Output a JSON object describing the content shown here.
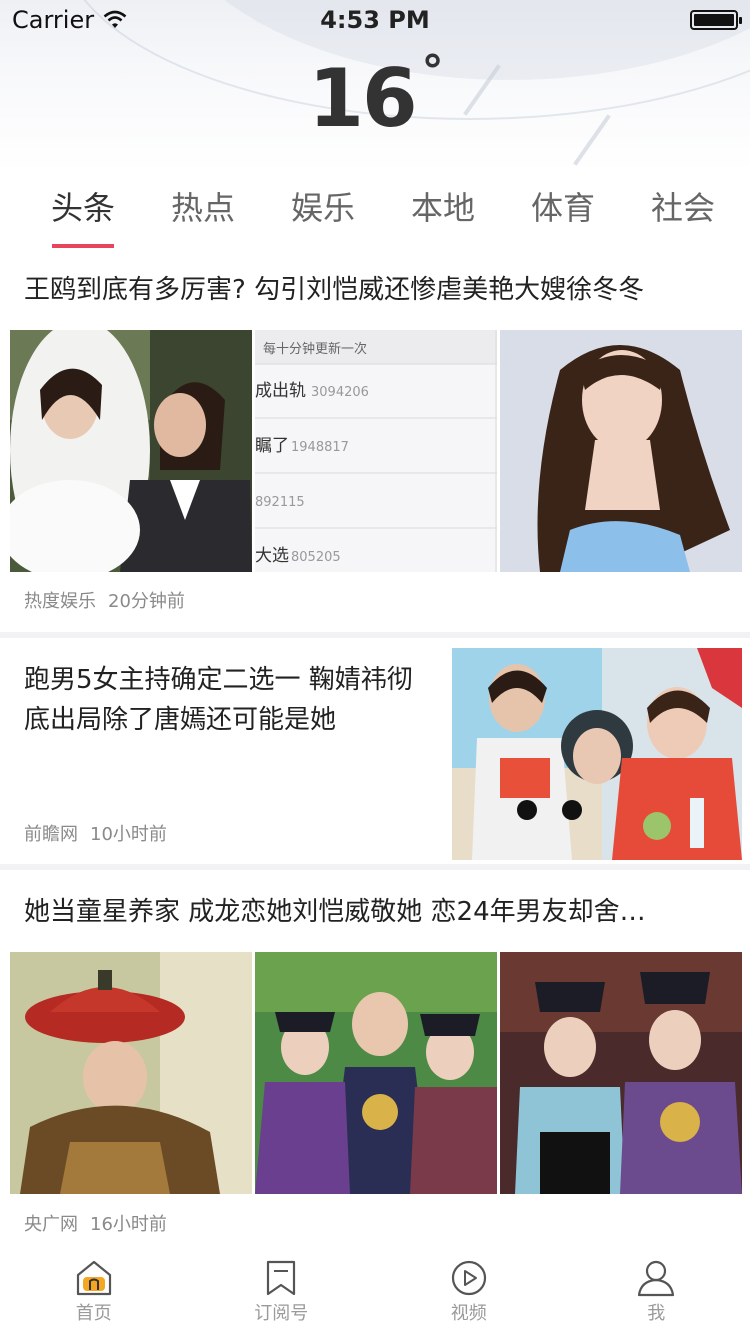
{
  "status": {
    "carrier": "Carrier",
    "time": "4:53 PM"
  },
  "weather": {
    "temperature": "16",
    "degree_symbol": "°"
  },
  "tabs": [
    "头条",
    "热点",
    "娱乐",
    "本地",
    "体育",
    "社会"
  ],
  "active_tab": 0,
  "articles": [
    {
      "title": "王鸥到底有多厉害? 勾引刘恺威还惨虐美艳大嫂徐冬冬",
      "source": "热度娱乐",
      "time": "20分钟前",
      "list_image": {
        "header": "每十分钟更新一次",
        "rows": [
          {
            "label": "成出轨",
            "value": "3094206"
          },
          {
            "label": "瞩了",
            "value": "1948817"
          },
          {
            "label": "",
            "value": "892115"
          },
          {
            "label": "大选",
            "value": "805205"
          }
        ]
      }
    },
    {
      "title": "跑男5女主持确定二选一 鞠婧祎彻底出局除了唐嫣还可能是她",
      "source": "前瞻网",
      "time": "10小时前"
    },
    {
      "title": "她当童星养家 成龙恋她刘恺威敬她 恋24年男友却舍…",
      "source": "央广网",
      "time": "16小时前"
    }
  ],
  "tabbar": [
    {
      "label": "首页",
      "icon": "home-icon"
    },
    {
      "label": "订阅号",
      "icon": "bookmark-icon"
    },
    {
      "label": "视频",
      "icon": "play-icon"
    },
    {
      "label": "我",
      "icon": "user-icon"
    }
  ],
  "colors": {
    "accent": "#e6465c",
    "home_active": "#f5a623"
  }
}
